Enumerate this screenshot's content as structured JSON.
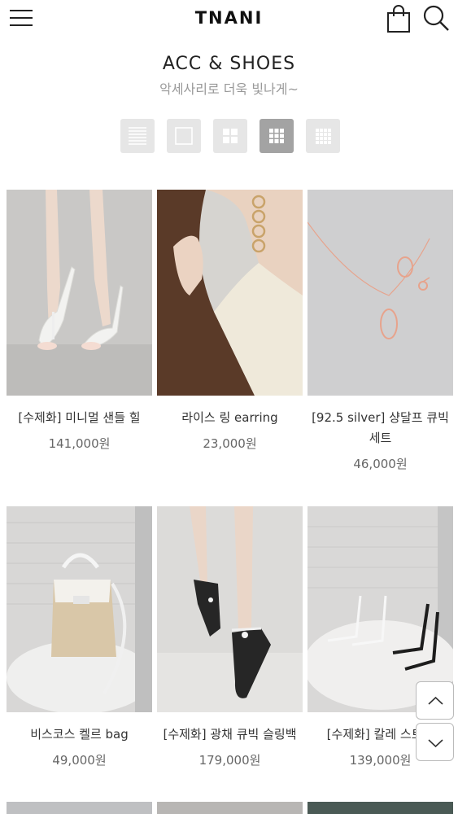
{
  "header": {
    "logo": "TNANI",
    "menu_icon": "hamburger-menu-icon",
    "cart_icon": "shopping-bag-icon",
    "search_icon": "search-icon"
  },
  "category": {
    "title": "ACC & SHOES",
    "subtitle": "악세사리로 더욱 빛나게~"
  },
  "view_modes": [
    {
      "icon": "list-view-icon",
      "active": false
    },
    {
      "icon": "single-view-icon",
      "active": false
    },
    {
      "icon": "grid-2-icon",
      "active": false
    },
    {
      "icon": "grid-3-icon",
      "active": true
    },
    {
      "icon": "grid-4-icon",
      "active": false
    }
  ],
  "products": [
    {
      "name": "[수제화] 미니멀 샌들 힐",
      "price": "141,000원"
    },
    {
      "name": "라이스 링 earring",
      "price": "23,000원"
    },
    {
      "name": "[92.5 silver] 샹달프 큐빅 세트",
      "price": "46,000원"
    },
    {
      "name": "비스코스 켈르 bag",
      "price": "49,000원"
    },
    {
      "name": "[수제화] 광채 큐빅 슬링백",
      "price": "179,000원"
    },
    {
      "name": "[수제화] 칼레 스트랩",
      "price": "139,000원"
    }
  ],
  "scroll_controls": {
    "up_icon": "chevron-up-icon",
    "down_icon": "chevron-down-icon"
  },
  "colors": {
    "active_toggle": "#a3a3a3",
    "inactive_toggle": "#e6e6e6",
    "price_text": "#666666"
  }
}
